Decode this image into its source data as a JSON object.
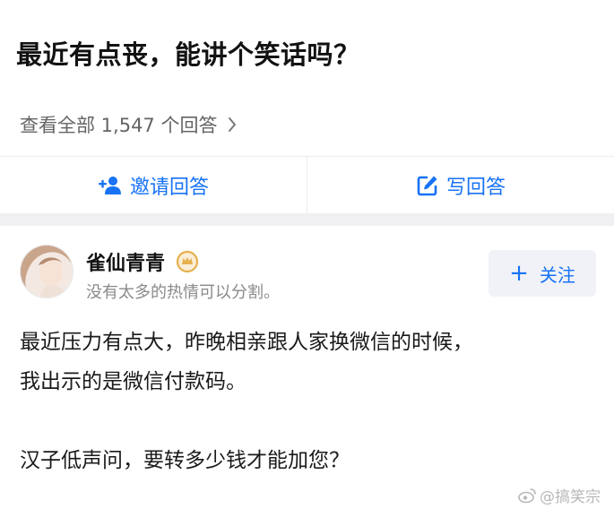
{
  "question": {
    "title": "最近有点丧，能讲个笑话吗？",
    "view_all": "查看全部 1,547 个回答"
  },
  "actions": {
    "invite_label": "邀请回答",
    "write_label": "写回答"
  },
  "author": {
    "name": "雀仙青青",
    "bio": "没有太多的热情可以分割。",
    "follow_label": "关注",
    "follow_icon": "+"
  },
  "answer": {
    "lines": [
      "最近压力有点大，昨晚相亲跟人家换微信的时候，",
      "我出示的是微信付款码。",
      "汉子低声问，要转多少钱才能加您？"
    ]
  },
  "watermark": {
    "text": "@搞笑宗"
  },
  "colors": {
    "accent": "#1772f6",
    "badge": "#e6b04e",
    "divider": "#f0f0f2"
  },
  "icons": [
    "chevron-right-icon",
    "add-user-icon",
    "edit-icon",
    "badge-icon",
    "weibo-icon"
  ]
}
